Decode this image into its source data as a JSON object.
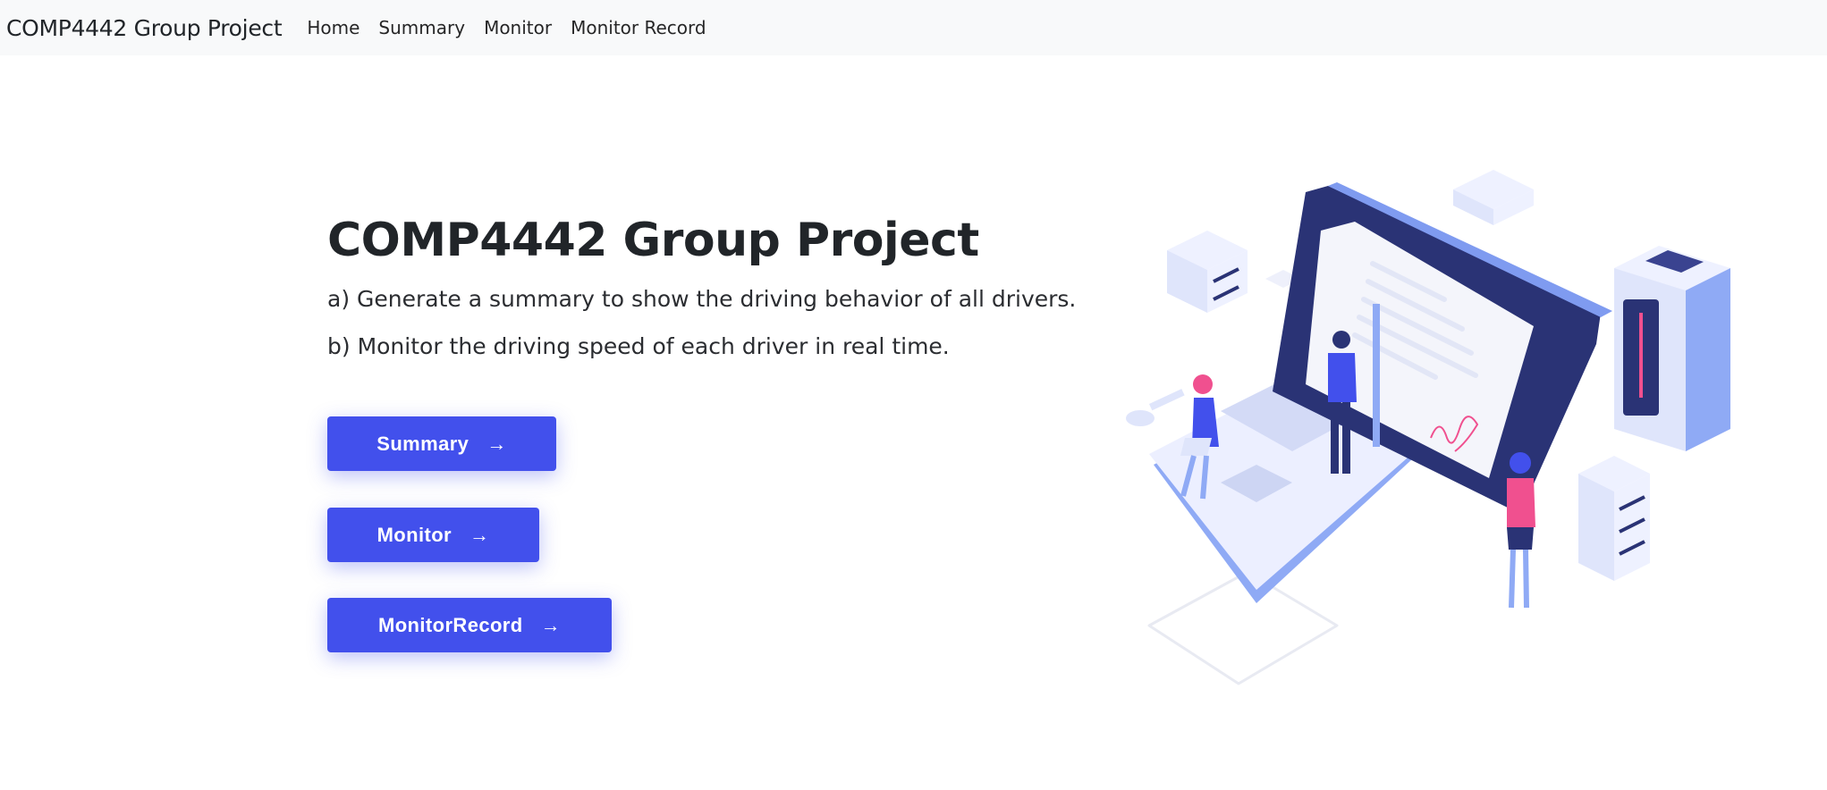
{
  "navbar": {
    "brand": "COMP4442 Group Project",
    "links": [
      {
        "label": "Home"
      },
      {
        "label": "Summary"
      },
      {
        "label": "Monitor"
      },
      {
        "label": "Monitor Record"
      }
    ]
  },
  "hero": {
    "title": "COMP4442 Group Project",
    "line_a": "a) Generate a summary to show the driving behavior of all drivers.",
    "line_b": "b) Monitor the driving speed of each driver in real time.",
    "buttons": [
      {
        "label": "Summary",
        "icon": "arrow-right-icon"
      },
      {
        "label": "Monitor",
        "icon": "arrow-right-icon"
      },
      {
        "label": "MonitorRecord",
        "icon": "arrow-right-icon"
      }
    ],
    "arrow_glyph": "→"
  },
  "illustration": {
    "signature": "Mgl"
  },
  "colors": {
    "accent": "#4250ec",
    "navbar_bg": "#f8f9fa",
    "laptop_dark": "#2a3375",
    "light_blue": "#8faaf5",
    "pink": "#f0508f"
  }
}
